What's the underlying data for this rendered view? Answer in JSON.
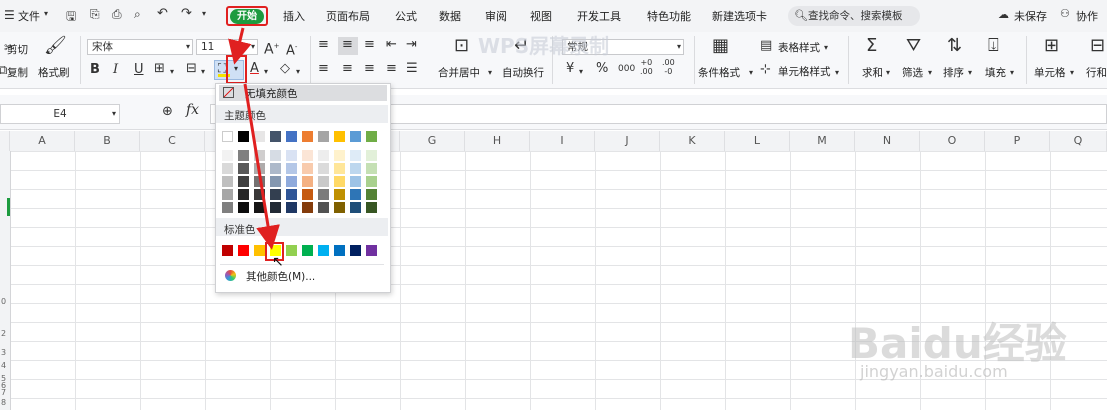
{
  "menubar": {
    "file_label": "文件",
    "tabs": [
      "开始",
      "插入",
      "页面布局",
      "公式",
      "数据",
      "审阅",
      "视图",
      "开发工具",
      "特色功能",
      "新建选项卡"
    ],
    "search_placeholder": "查找命令、搜索模板",
    "unsaved_label": "未保存",
    "collab_label": "协作"
  },
  "ribbon": {
    "cut_label": "剪切",
    "copy_label": "复制",
    "format_painter_label": "格式刷",
    "font_name": "宋体",
    "font_size": "11",
    "merge_center_label": "合并居中",
    "wrap_text_label": "自动换行",
    "number_format": "常规",
    "table_style_label": "表格样式",
    "cond_format_label": "条件格式",
    "cell_style_label": "单元格样式",
    "sum_label": "求和",
    "filter_label": "筛选",
    "sort_label": "排序",
    "fill_label": "填充",
    "cell_label": "单元格",
    "rowcol_label": "行和",
    "currency_symbol": "¥",
    "percent_symbol": "%"
  },
  "formula_bar": {
    "cell_ref": "E4",
    "fx_label": "fx"
  },
  "columns": [
    "A",
    "B",
    "C",
    "D",
    "E",
    "F",
    "G",
    "H",
    "I",
    "J",
    "K",
    "L",
    "M",
    "N",
    "O",
    "P",
    "Q"
  ],
  "row_labels": [
    "0",
    "2",
    "3",
    "4",
    "5",
    "6",
    "7",
    "8"
  ],
  "dropdown": {
    "no_fill_label": "无填充颜色",
    "theme_colors_title": "主题颜色",
    "standard_colors_title": "标准色",
    "more_colors_label": "其他颜色(M)...",
    "theme_top_row": [
      "#ffffff",
      "#000000",
      "#e7e6e6",
      "#44546a",
      "#4472c4",
      "#ed7d31",
      "#a5a5a5",
      "#ffc000",
      "#5b9bd5",
      "#70ad47"
    ],
    "theme_shades": [
      [
        "#f2f2f2",
        "#808080",
        "#d0cece",
        "#d6dce4",
        "#d9e2f3",
        "#fbe5d6",
        "#ededed",
        "#fff2cc",
        "#deebf7",
        "#e2f0d9"
      ],
      [
        "#d9d9d9",
        "#595959",
        "#aeabab",
        "#adb9ca",
        "#b4c7e7",
        "#f8cbad",
        "#dbdbdb",
        "#ffe699",
        "#bdd7ee",
        "#c5e0b4"
      ],
      [
        "#bfbfbf",
        "#404040",
        "#757171",
        "#8497b0",
        "#8faadc",
        "#f4b183",
        "#c9c9c9",
        "#ffd966",
        "#9dc3e6",
        "#a9d18e"
      ],
      [
        "#a6a6a6",
        "#262626",
        "#3a3838",
        "#333f50",
        "#2f5597",
        "#c55a11",
        "#7b7b7b",
        "#bf9000",
        "#2e75b6",
        "#548235"
      ],
      [
        "#7f7f7f",
        "#0d0d0d",
        "#171616",
        "#222a35",
        "#1f3864",
        "#843c0c",
        "#525252",
        "#7f6000",
        "#1f4e79",
        "#375623"
      ]
    ],
    "standard_colors": [
      "#c00000",
      "#ff0000",
      "#ffc000",
      "#ffff00",
      "#92d050",
      "#00b050",
      "#00b0f0",
      "#0070c0",
      "#002060",
      "#7030a0"
    ]
  },
  "watermark": {
    "top": "WPS屏幕录制",
    "baidu": "Baidu经验",
    "url": "jingyan.baidu.com"
  }
}
